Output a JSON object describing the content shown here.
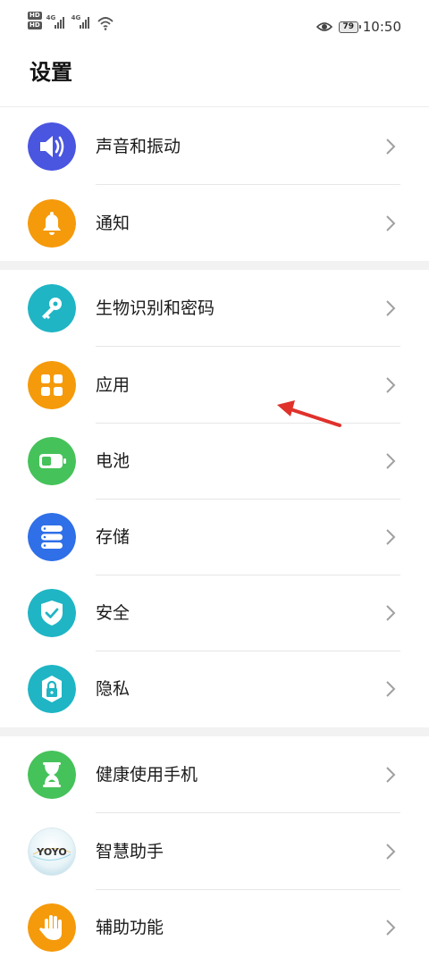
{
  "status_bar": {
    "hd_badge": "HD",
    "signal_1": "4G",
    "signal_2": "4G",
    "battery": "79",
    "time": "10:50"
  },
  "page": {
    "title": "设置"
  },
  "groups": [
    {
      "items": [
        {
          "key": "sound",
          "label": "声音和振动",
          "icon": "speaker-icon",
          "color": "#4a55e0"
        },
        {
          "key": "notifications",
          "label": "通知",
          "icon": "bell-icon",
          "color": "#f59a0b"
        }
      ]
    },
    {
      "items": [
        {
          "key": "biometrics",
          "label": "生物识别和密码",
          "icon": "key-icon",
          "color": "#1fb5c4"
        },
        {
          "key": "apps",
          "label": "应用",
          "icon": "apps-grid-icon",
          "color": "#f59a0b"
        },
        {
          "key": "battery",
          "label": "电池",
          "icon": "battery-icon",
          "color": "#46c25a"
        },
        {
          "key": "storage",
          "label": "存储",
          "icon": "storage-icon",
          "color": "#2f6fe8"
        },
        {
          "key": "security",
          "label": "安全",
          "icon": "shield-icon",
          "color": "#1fb5c4"
        },
        {
          "key": "privacy",
          "label": "隐私",
          "icon": "lock-icon",
          "color": "#1fb5c4"
        }
      ]
    },
    {
      "items": [
        {
          "key": "digital_balance",
          "label": "健康使用手机",
          "icon": "hourglass-icon",
          "color": "#46c25a"
        },
        {
          "key": "assistant",
          "label": "智慧助手",
          "icon": "yoyo-logo-icon",
          "icon_text": "YOYO",
          "color": "#e6f3f7"
        },
        {
          "key": "accessibility",
          "label": "辅助功能",
          "icon": "hand-icon",
          "color": "#f59a0b"
        }
      ]
    }
  ],
  "annotation": {
    "arrow_color": "#e0312b",
    "points_to": "应用"
  }
}
